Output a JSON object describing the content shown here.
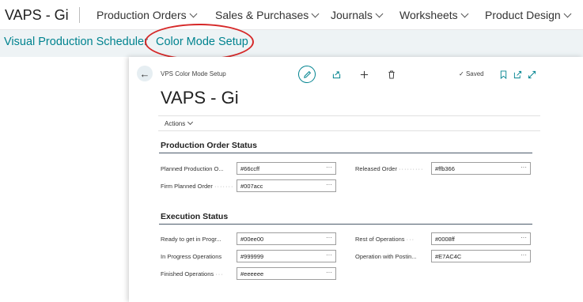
{
  "app": {
    "company": "VAPS - Gi",
    "nav": [
      "Production Orders",
      "Sales & Purchases",
      "Journals",
      "Worksheets",
      "Product Design"
    ]
  },
  "links": [
    "Visual Production Scheduler",
    "Color Mode Setup"
  ],
  "page": {
    "breadcrumb": "VPS Color Mode Setup",
    "title": "VAPS - Gi",
    "saved": "Saved",
    "actions": "Actions"
  },
  "sections": {
    "production": {
      "title": "Production Order Status",
      "fields": {
        "planned": {
          "label": "Planned Production O...",
          "value": "#66ccff"
        },
        "firm": {
          "label": "Firm Planned Order",
          "value": "#007acc"
        },
        "released": {
          "label": "Released Order",
          "value": "#ffb366"
        }
      }
    },
    "execution": {
      "title": "Execution Status",
      "fields": {
        "ready": {
          "label": "Ready to get in Progr...",
          "value": "#00ee00"
        },
        "inprogress": {
          "label": "In Progress Operations",
          "value": "#999999"
        },
        "finished": {
          "label": "Finished Operations",
          "value": "#eeeeee"
        },
        "rest": {
          "label": "Rest of Operations",
          "value": "#0008ff"
        },
        "posting": {
          "label": "Operation with Postin...",
          "value": "#E7AC4C"
        }
      }
    }
  },
  "colors": {
    "accent": "#00838f",
    "highlight": "#d62828"
  }
}
